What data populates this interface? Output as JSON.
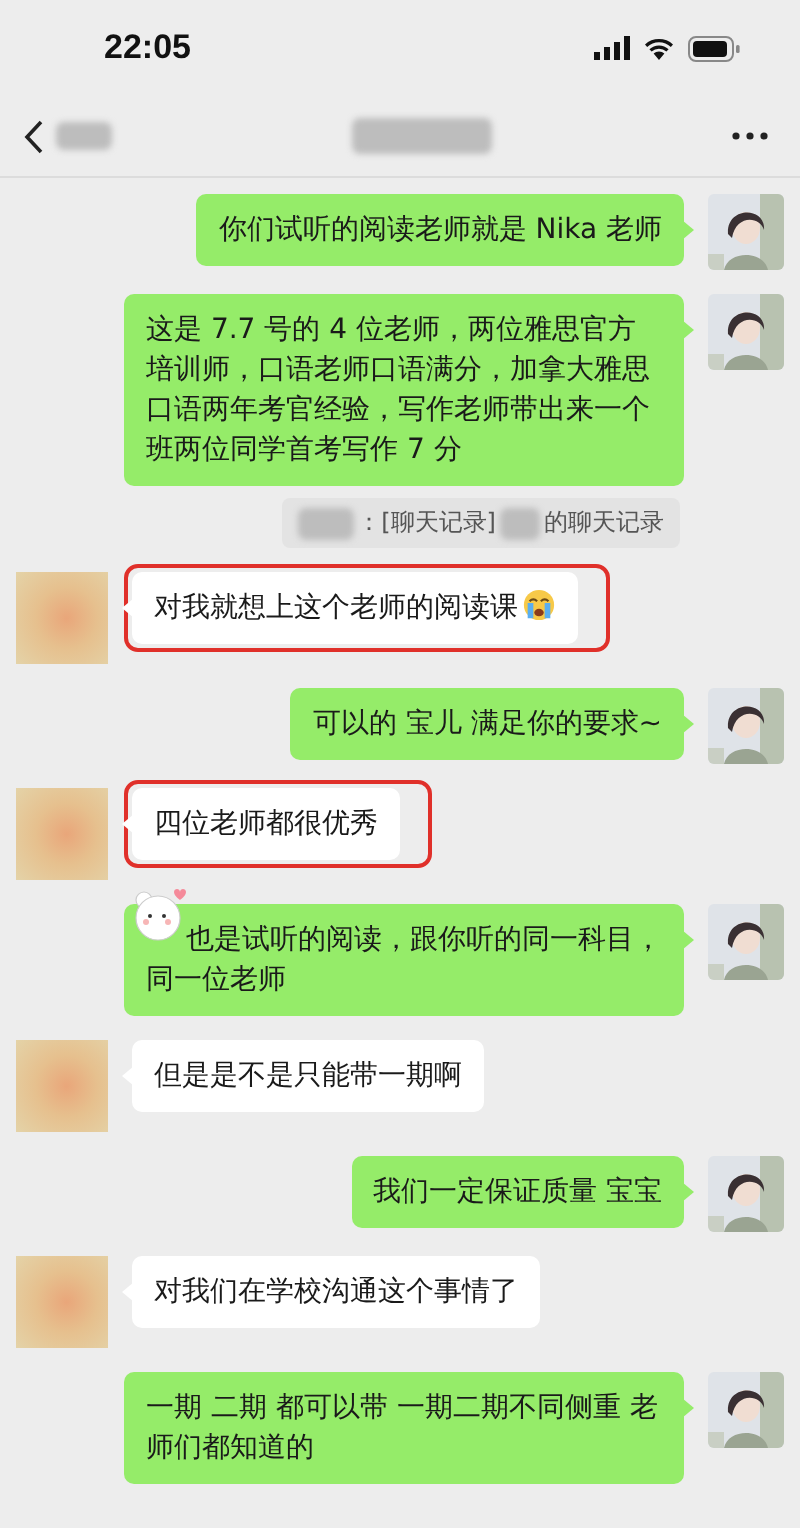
{
  "status_bar": {
    "time": "22:05"
  },
  "messages": [
    {
      "kind": "sent",
      "text": "你们试听的阅读老师就是 Nika 老师"
    },
    {
      "kind": "sent",
      "text": "这是 7.7 号的 4 位老师，两位雅思官方培训师，口语老师口语满分，加拿大雅思口语两年考官经验，写作老师带出来一个班两位同学首考写作 7 分"
    },
    {
      "kind": "record",
      "parts": [
        "：[聊天记录]",
        "的聊天记录"
      ]
    },
    {
      "kind": "received",
      "text": "对我就想上这个老师的阅读课",
      "highlighted": true,
      "crying_emoji": true
    },
    {
      "kind": "sent",
      "text": "可以的 宝儿 满足你的要求~"
    },
    {
      "kind": "received",
      "text": "四位老师都很优秀",
      "highlighted": true
    },
    {
      "kind": "sent",
      "text": "也是试听的阅读，跟你听的同一科目，同一位老师",
      "sticker": true
    },
    {
      "kind": "received",
      "text": "但是是不是只能带一期啊",
      "highlighted": false
    },
    {
      "kind": "sent",
      "text": "我们一定保证质量 宝宝"
    },
    {
      "kind": "received",
      "text": "对我们在学校沟通这个事情了",
      "highlighted": false
    },
    {
      "kind": "sent",
      "text": "一期 二期 都可以带 一期二期不同侧重 老师们都知道的"
    }
  ]
}
